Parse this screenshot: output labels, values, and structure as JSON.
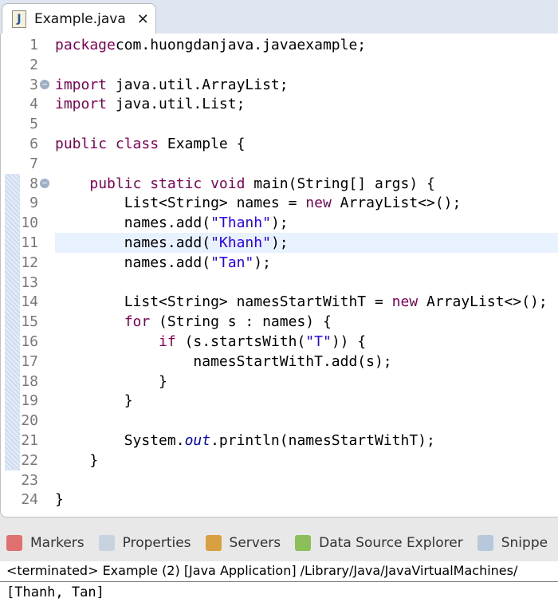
{
  "editor_tab": {
    "title": "Example.java",
    "icon": "java-file-icon",
    "close_icon": "close-icon"
  },
  "code": {
    "highlighted_line": 11,
    "folds": [
      3,
      8
    ],
    "lines": [
      [
        [
          "kw",
          "package"
        ],
        [
          "",
          "com.huongdanjava.javaexample;"
        ]
      ],
      [],
      [
        [
          "kw",
          "import"
        ],
        [
          "",
          " java.util.ArrayList;"
        ]
      ],
      [
        [
          "kw",
          "import"
        ],
        [
          "",
          " java.util.List;"
        ]
      ],
      [],
      [
        [
          "kw",
          "public class"
        ],
        [
          "",
          " Example {"
        ]
      ],
      [],
      [
        [
          "",
          "    "
        ],
        [
          "kw",
          "public static void"
        ],
        [
          "",
          " main(String[] args) {"
        ]
      ],
      [
        [
          "",
          "        List<String> names = "
        ],
        [
          "kw",
          "new"
        ],
        [
          "",
          " ArrayList<>();"
        ]
      ],
      [
        [
          "",
          "        names.add("
        ],
        [
          "str",
          "\"Thanh\""
        ],
        [
          "",
          ");"
        ]
      ],
      [
        [
          "",
          "        names.add("
        ],
        [
          "str",
          "\"Khanh\""
        ],
        [
          "",
          ");"
        ]
      ],
      [
        [
          "",
          "        names.add("
        ],
        [
          "str",
          "\"Tan\""
        ],
        [
          "",
          ");"
        ]
      ],
      [],
      [
        [
          "",
          "        List<String> namesStartWithT = "
        ],
        [
          "kw",
          "new"
        ],
        [
          "",
          " ArrayList<>();"
        ]
      ],
      [
        [
          "",
          "        "
        ],
        [
          "kw",
          "for"
        ],
        [
          "",
          " (String s : names) {"
        ]
      ],
      [
        [
          "",
          "            "
        ],
        [
          "kw",
          "if"
        ],
        [
          "",
          " (s.startsWith("
        ],
        [
          "str",
          "\"T\""
        ],
        [
          "",
          ")) {"
        ]
      ],
      [
        [
          "",
          "                namesStartWithT.add(s);"
        ]
      ],
      [
        [
          "",
          "            }"
        ]
      ],
      [
        [
          "",
          "        }"
        ]
      ],
      [],
      [
        [
          "",
          "        System."
        ],
        [
          "fld",
          "out"
        ],
        [
          "",
          ".println(namesStartWithT);"
        ]
      ],
      [
        [
          "",
          "    }"
        ]
      ],
      [],
      [
        [
          "",
          "}"
        ]
      ]
    ]
  },
  "views": [
    {
      "label": "Markers",
      "icon": "markers-icon",
      "color": "#e07070"
    },
    {
      "label": "Properties",
      "icon": "properties-icon",
      "color": "#c9d3e0"
    },
    {
      "label": "Servers",
      "icon": "servers-icon",
      "color": "#d8a040"
    },
    {
      "label": "Data Source Explorer",
      "icon": "data-source-explorer-icon",
      "color": "#8cbf5a"
    },
    {
      "label": "Snippe",
      "icon": "snippets-icon",
      "color": "#b8c8dc"
    }
  ],
  "console": {
    "status": "<terminated> Example (2) [Java Application] /Library/Java/JavaVirtualMachines/",
    "output": "[Thanh, Tan]"
  }
}
